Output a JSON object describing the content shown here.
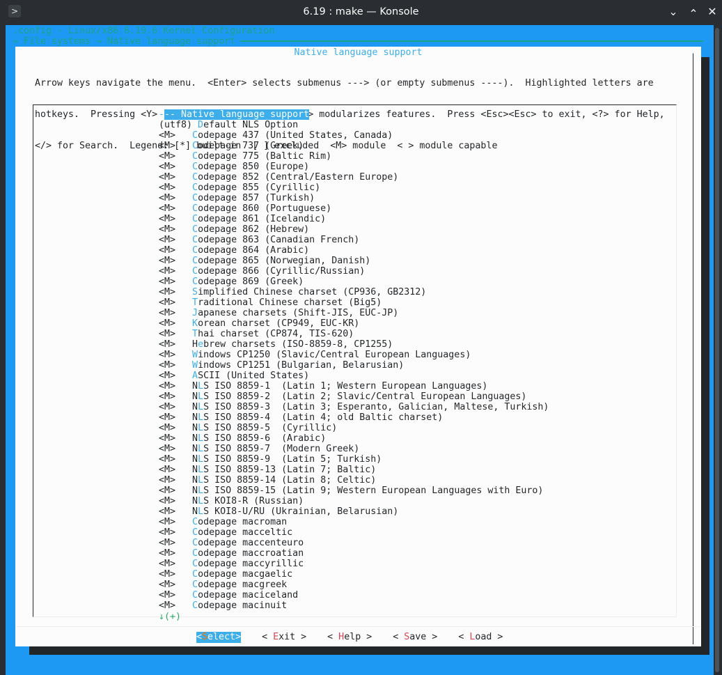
{
  "window": {
    "title": "6.19 : make — Konsole"
  },
  "header": {
    "config": ".config - Linux/x86 6.19.6 Kernel Configuration",
    "breadcrumb": "→ File systems → Native language support"
  },
  "dialog": {
    "title": "Native language support",
    "help": [
      "Arrow keys navigate the menu.  <Enter> selects submenus ---> (or empty submenus ----).  Highlighted letters are",
      "hotkeys.  Pressing <Y> includes, <N> excludes, <M> modularizes features.  Press <Esc><Esc> to exit, <?> for Help,",
      "</> for Search.  Legend: [*] built-in  [ ] excluded  <M> module  < > module capable"
    ]
  },
  "menu": {
    "items": [
      {
        "state": "",
        "pre": "-",
        "key": "",
        "post": "-- Native language support",
        "selected": true
      },
      {
        "state": "(utf8) ",
        "pre": "",
        "key": "D",
        "post": "efault NLS Option"
      },
      {
        "state": "<M>   ",
        "pre": "",
        "key": "C",
        "post": "odepage 437 (United States, Canada)"
      },
      {
        "state": "<M>   ",
        "pre": "",
        "key": "C",
        "post": "odepage 737 (Greek)"
      },
      {
        "state": "<M>   ",
        "pre": "",
        "key": "C",
        "post": "odepage 775 (Baltic Rim)"
      },
      {
        "state": "<M>   ",
        "pre": "",
        "key": "C",
        "post": "odepage 850 (Europe)"
      },
      {
        "state": "<M>   ",
        "pre": "",
        "key": "C",
        "post": "odepage 852 (Central/Eastern Europe)"
      },
      {
        "state": "<M>   ",
        "pre": "",
        "key": "C",
        "post": "odepage 855 (Cyrillic)"
      },
      {
        "state": "<M>   ",
        "pre": "",
        "key": "C",
        "post": "odepage 857 (Turkish)"
      },
      {
        "state": "<M>   ",
        "pre": "",
        "key": "C",
        "post": "odepage 860 (Portuguese)"
      },
      {
        "state": "<M>   ",
        "pre": "",
        "key": "C",
        "post": "odepage 861 (Icelandic)"
      },
      {
        "state": "<M>   ",
        "pre": "",
        "key": "C",
        "post": "odepage 862 (Hebrew)"
      },
      {
        "state": "<M>   ",
        "pre": "",
        "key": "C",
        "post": "odepage 863 (Canadian French)"
      },
      {
        "state": "<M>   ",
        "pre": "",
        "key": "C",
        "post": "odepage 864 (Arabic)"
      },
      {
        "state": "<M>   ",
        "pre": "",
        "key": "C",
        "post": "odepage 865 (Norwegian, Danish)"
      },
      {
        "state": "<M>   ",
        "pre": "",
        "key": "C",
        "post": "odepage 866 (Cyrillic/Russian)"
      },
      {
        "state": "<M>   ",
        "pre": "",
        "key": "C",
        "post": "odepage 869 (Greek)"
      },
      {
        "state": "<M>   ",
        "pre": "",
        "key": "S",
        "post": "implified Chinese charset (CP936, GB2312)"
      },
      {
        "state": "<M>   ",
        "pre": "",
        "key": "T",
        "post": "raditional Chinese charset (Big5)"
      },
      {
        "state": "<M>   ",
        "pre": "",
        "key": "J",
        "post": "apanese charsets (Shift-JIS, EUC-JP)"
      },
      {
        "state": "<M>   ",
        "pre": "",
        "key": "K",
        "post": "orean charset (CP949, EUC-KR)"
      },
      {
        "state": "<M>   ",
        "pre": "",
        "key": "T",
        "post": "hai charset (CP874, TIS-620)"
      },
      {
        "state": "<M>   ",
        "pre": "H",
        "key": "e",
        "post": "brew charsets (ISO-8859-8, CP1255)"
      },
      {
        "state": "<M>   ",
        "pre": "",
        "key": "W",
        "post": "indows CP1250 (Slavic/Central European Languages)"
      },
      {
        "state": "<M>   ",
        "pre": "",
        "key": "W",
        "post": "indows CP1251 (Bulgarian, Belarusian)"
      },
      {
        "state": "<M>   ",
        "pre": "",
        "key": "A",
        "post": "SCII (United States)"
      },
      {
        "state": "<M>   ",
        "pre": "N",
        "key": "L",
        "post": "S ISO 8859-1  (Latin 1; Western European Languages)"
      },
      {
        "state": "<M>   ",
        "pre": "N",
        "key": "L",
        "post": "S ISO 8859-2  (Latin 2; Slavic/Central European Languages)"
      },
      {
        "state": "<M>   ",
        "pre": "N",
        "key": "L",
        "post": "S ISO 8859-3  (Latin 3; Esperanto, Galician, Maltese, Turkish)"
      },
      {
        "state": "<M>   ",
        "pre": "N",
        "key": "L",
        "post": "S ISO 8859-4  (Latin 4; old Baltic charset)"
      },
      {
        "state": "<M>   ",
        "pre": "N",
        "key": "L",
        "post": "S ISO 8859-5  (Cyrillic)"
      },
      {
        "state": "<M>   ",
        "pre": "N",
        "key": "L",
        "post": "S ISO 8859-6  (Arabic)"
      },
      {
        "state": "<M>   ",
        "pre": "N",
        "key": "L",
        "post": "S ISO 8859-7  (Modern Greek)"
      },
      {
        "state": "<M>   ",
        "pre": "N",
        "key": "L",
        "post": "S ISO 8859-9  (Latin 5; Turkish)"
      },
      {
        "state": "<M>   ",
        "pre": "N",
        "key": "L",
        "post": "S ISO 8859-13 (Latin 7; Baltic)"
      },
      {
        "state": "<M>   ",
        "pre": "N",
        "key": "L",
        "post": "S ISO 8859-14 (Latin 8; Celtic)"
      },
      {
        "state": "<M>   ",
        "pre": "N",
        "key": "L",
        "post": "S ISO 8859-15 (Latin 9; Western European Languages with Euro)"
      },
      {
        "state": "<M>   ",
        "pre": "N",
        "key": "L",
        "post": "S KOI8-R (Russian)"
      },
      {
        "state": "<M>   ",
        "pre": "N",
        "key": "L",
        "post": "S KOI8-U/RU (Ukrainian, Belarusian)"
      },
      {
        "state": "<M>   ",
        "pre": "",
        "key": "C",
        "post": "odepage macroman"
      },
      {
        "state": "<M>   ",
        "pre": "",
        "key": "C",
        "post": "odepage macceltic"
      },
      {
        "state": "<M>   ",
        "pre": "",
        "key": "C",
        "post": "odepage maccenteuro"
      },
      {
        "state": "<M>   ",
        "pre": "",
        "key": "C",
        "post": "odepage maccroatian"
      },
      {
        "state": "<M>   ",
        "pre": "",
        "key": "C",
        "post": "odepage maccyrillic"
      },
      {
        "state": "<M>   ",
        "pre": "",
        "key": "C",
        "post": "odepage macgaelic"
      },
      {
        "state": "<M>   ",
        "pre": "",
        "key": "C",
        "post": "odepage macgreek"
      },
      {
        "state": "<M>   ",
        "pre": "",
        "key": "C",
        "post": "odepage maciceland"
      },
      {
        "state": "<M>   ",
        "pre": "",
        "key": "C",
        "post": "odepage macinuit"
      }
    ],
    "more": "↓(+)"
  },
  "buttons": [
    {
      "open": "<",
      "key": "S",
      "rest": "elect",
      "close": ">",
      "active": true
    },
    {
      "open": "< ",
      "key": "E",
      "rest": "xit",
      "close": " >"
    },
    {
      "open": "< ",
      "key": "H",
      "rest": "elp",
      "close": " >"
    },
    {
      "open": "< ",
      "key": "S",
      "rest": "ave",
      "close": " >"
    },
    {
      "open": "< ",
      "key": "L",
      "rest": "oad",
      "close": " >"
    }
  ]
}
